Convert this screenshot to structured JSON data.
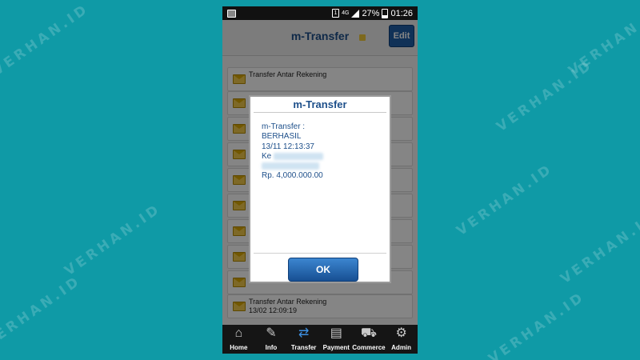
{
  "background": {
    "color": "#0f9aa6"
  },
  "watermark": {
    "text": "VERHAN.ID"
  },
  "status_bar": {
    "battery_percent": "27%",
    "time": "01:26",
    "network": "4G",
    "sim": "1"
  },
  "header": {
    "title": "m-Transfer",
    "edit_label": "Edit"
  },
  "list": {
    "items": [
      {
        "title": "Transfer Antar Rekening",
        "date": ""
      },
      {
        "title": "",
        "date": ""
      },
      {
        "title": "",
        "date": ""
      },
      {
        "title": "",
        "date": ""
      },
      {
        "title": "",
        "date": ""
      },
      {
        "title": "",
        "date": ""
      },
      {
        "title": "",
        "date": ""
      },
      {
        "title": "",
        "date": ""
      },
      {
        "title": "",
        "date": ""
      },
      {
        "title": "Transfer Antar Rekening",
        "date": "13/02 12:09:19"
      }
    ]
  },
  "dialog": {
    "title": "m-Transfer",
    "line1": "m-Transfer :",
    "line2": "BERHASIL",
    "line3": "13/11 12:13:37",
    "line4_prefix": "Ke",
    "line7": "Rp. 4,000.000.00",
    "ok_label": "OK"
  },
  "bottom_nav": {
    "items": [
      {
        "label": "Home",
        "icon": "home-icon"
      },
      {
        "label": "Info",
        "icon": "info-icon"
      },
      {
        "label": "Transfer",
        "icon": "transfer-icon"
      },
      {
        "label": "Payment",
        "icon": "payment-icon"
      },
      {
        "label": "Commerce",
        "icon": "cart-icon"
      },
      {
        "label": "Admin",
        "icon": "admin-icon"
      }
    ]
  },
  "colors": {
    "accent_blue": "#1d4f8a",
    "button_blue": "#1f5fa8",
    "header_dot": "#f0c93a"
  }
}
